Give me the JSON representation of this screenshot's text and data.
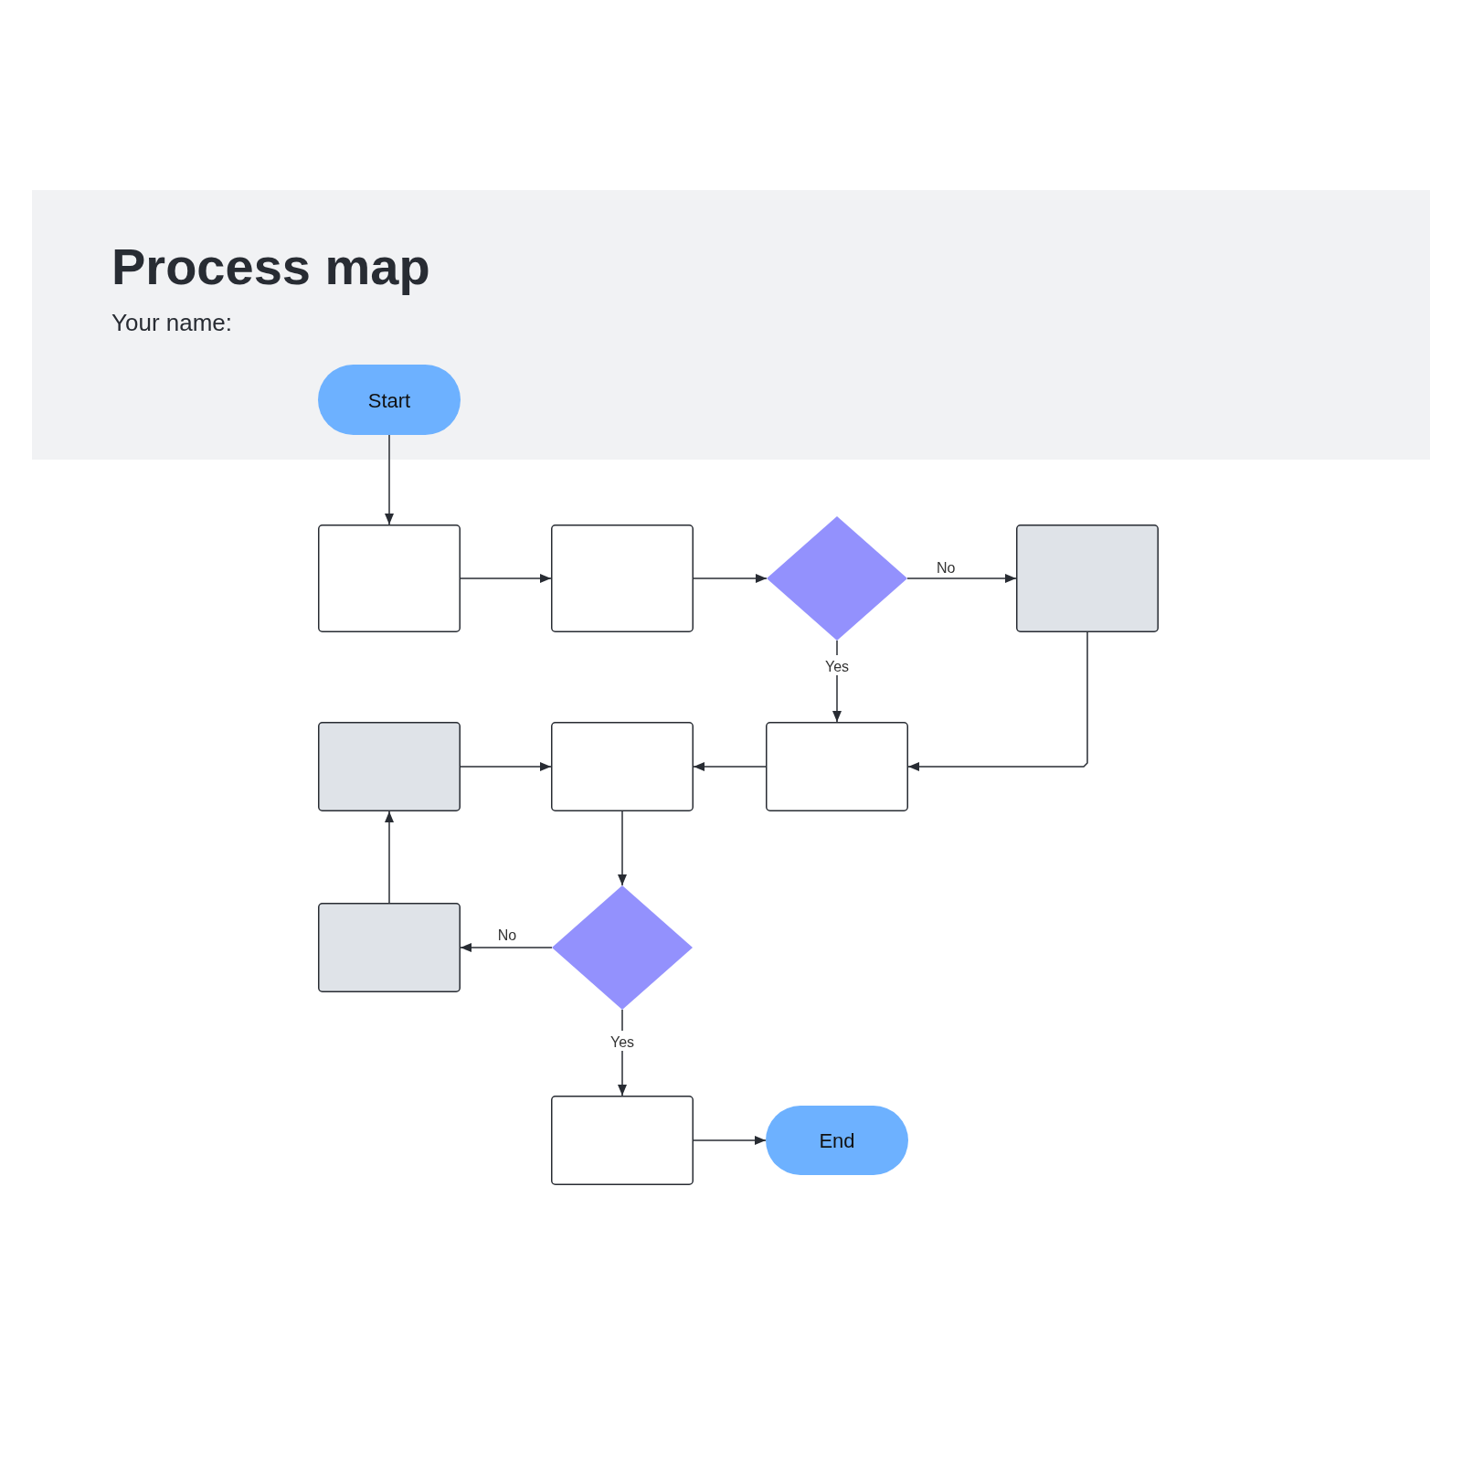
{
  "header": {
    "title": "Process map",
    "name_label": "Your name:"
  },
  "nodes": [
    {
      "kind": "terminal",
      "label": "Start",
      "color": "#6db1ff"
    },
    {
      "kind": "process",
      "color": "#ffffff"
    },
    {
      "kind": "process",
      "color": "#ffffff"
    },
    {
      "kind": "decision",
      "color": "#9391fd"
    },
    {
      "kind": "process",
      "color": "#dfe3e8"
    },
    {
      "kind": "process",
      "color": "#dfe3e8"
    },
    {
      "kind": "process",
      "color": "#ffffff"
    },
    {
      "kind": "process",
      "color": "#ffffff"
    },
    {
      "kind": "decision",
      "color": "#9391fd"
    },
    {
      "kind": "process",
      "color": "#dfe3e8"
    },
    {
      "kind": "process",
      "color": "#ffffff"
    },
    {
      "kind": "terminal",
      "label": "End",
      "color": "#6db1ff"
    }
  ],
  "edge_labels": [
    {
      "text": "No"
    },
    {
      "text": "Yes"
    },
    {
      "text": "No"
    },
    {
      "text": "Yes"
    }
  ]
}
